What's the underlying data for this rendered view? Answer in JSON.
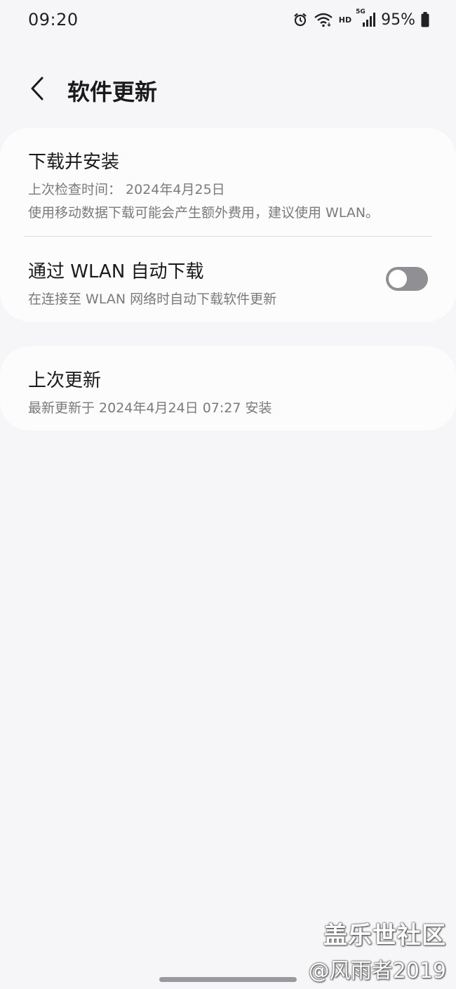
{
  "status_bar": {
    "time": "09:20",
    "hd_label": "HD",
    "network_label": "5G",
    "battery_percent": "95%",
    "icons": [
      "alarm-icon",
      "wifi-icon",
      "signal-icon",
      "battery-icon"
    ]
  },
  "header": {
    "title": "软件更新",
    "back_icon": "chevron-left-icon"
  },
  "download_card": {
    "download_install": {
      "title": "下载并安装",
      "last_check": "上次检查时间： 2024年4月25日",
      "notice": "使用移动数据下载可能会产生额外费用，建议使用 WLAN。"
    },
    "auto_download": {
      "title": "通过 WLAN 自动下载",
      "description": "在连接至 WLAN 网络时自动下载软件更新",
      "enabled": false
    }
  },
  "last_update_card": {
    "title": "上次更新",
    "description": "最新更新于 2024年4月24日 07:27 安装"
  },
  "watermark": {
    "line1": "盖乐世社区",
    "line2": "@风雨者2019"
  },
  "colors": {
    "background": "#f6f6f8",
    "card": "#fcfcfd",
    "toggle_off": "#8f8f94",
    "secondary_text": "#7a7a7a"
  }
}
